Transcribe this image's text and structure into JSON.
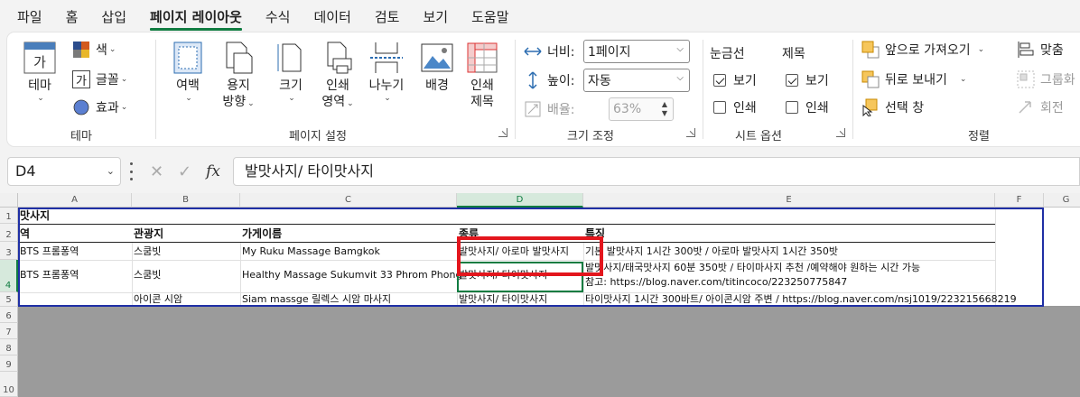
{
  "menu": {
    "tabs": [
      "파일",
      "홈",
      "삽입",
      "페이지 레이아웃",
      "수식",
      "데이터",
      "검토",
      "보기",
      "도움말"
    ],
    "active": 3
  },
  "ribbon": {
    "theme_group": {
      "label": "테마",
      "theme_button": "테마",
      "colors": "색",
      "fonts": "글꼴",
      "effects": "효과",
      "font_glyph": "가"
    },
    "page_setup_group": {
      "label": "페이지 설정",
      "margins": "여백",
      "orientation_1": "용지",
      "orientation_2": "방향",
      "size": "크기",
      "print_area_1": "인쇄",
      "print_area_2": "영역",
      "breaks": "나누기",
      "background": "배경",
      "print_titles_1": "인쇄",
      "print_titles_2": "제목"
    },
    "scale_group": {
      "label": "크기 조정",
      "width_label": "너비:",
      "width_value": "1페이지",
      "height_label": "높이:",
      "height_value": "자동",
      "scale_label": "배율:",
      "scale_value": "63%"
    },
    "sheet_options_group": {
      "label": "시트 옵션",
      "gridlines": "눈금선",
      "headings": "제목",
      "view": "보기",
      "print": "인쇄"
    },
    "arrange_group": {
      "label": "정렬",
      "bring_forward": "앞으로 가져오기",
      "send_backward": "뒤로 보내기",
      "selection_pane": "선택 창",
      "align": "맞춤",
      "group": "그룹화",
      "rotate": "회전"
    }
  },
  "formula_bar": {
    "name_box": "D4",
    "fx": "fx",
    "content": "발맛사지/ 타이맛사지"
  },
  "grid": {
    "columns": [
      "A",
      "B",
      "C",
      "D",
      "E",
      "F",
      "G"
    ],
    "rows": [
      "1",
      "2",
      "3",
      "4",
      "5",
      "6",
      "7",
      "8",
      "9",
      "10"
    ],
    "selected_column": "D",
    "selected_row": "4",
    "cells": {
      "a1": "맛사지",
      "a2": "역",
      "b2": "관광지",
      "c2": "가게이름",
      "d2": "종류",
      "e2": "특징",
      "a3": "BTS 프롬퐁역",
      "b3": "스쿰빗",
      "c3": "My Ruku Massage Bamgkok",
      "d3": "발맛사지/ 아로마 발맛사지",
      "e3": "기본 발맛사지 1시간 300밧 / 아로마 발맛사지 1시간 350밧",
      "a4": "BTS 프롬퐁역",
      "b4": "스쿰빗",
      "c4": "Healthy Massage Sukumvit 33 Phrom Phong",
      "d4": "발맛사지/ 타이맛사지",
      "e4_1": "발맛사지/태국맛사지 60분 350밧  / 타이마사지 추천 /예약해야 원하는 시간 가능",
      "e4_2": "참고: https://blog.naver.com/titincoco/223250775847",
      "b5": "아이콘 시암",
      "c5": "Siam massge 릴렉스 시암 마사지",
      "d5": "발맛사지/ 타이맛사지",
      "e5": "타이맛사지 1시간 300바트/  아이콘시암 주변 / https://blog.naver.com/nsj1019/223215668219"
    }
  },
  "colors": {
    "excel_green": "#107c41",
    "frame_blue": "#1f2fa5",
    "highlight_red": "#e3161d"
  }
}
